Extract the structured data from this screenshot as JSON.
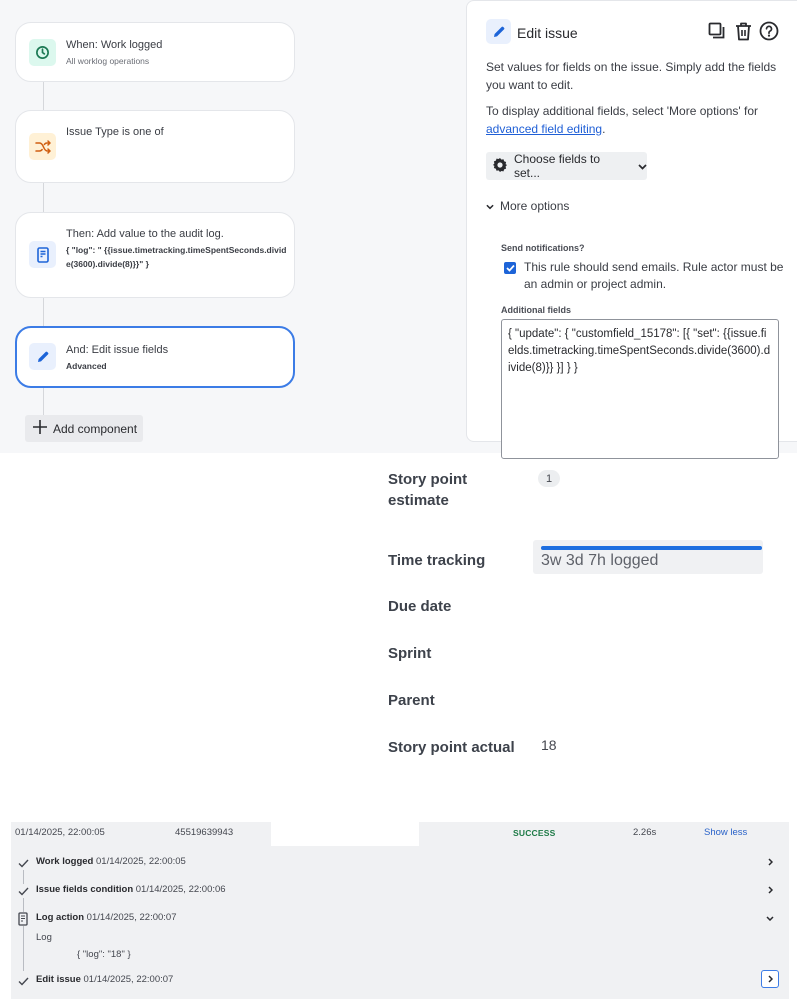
{
  "rule_editor": {
    "components": [
      {
        "title": "When: Work logged",
        "subtitle": "All worklog operations",
        "icon": "clock-icon",
        "icon_bg": "#dcf8ee",
        "icon_color": "#1d7a55"
      },
      {
        "title": "Issue Type is one of",
        "subtitle": "",
        "icon": "shuffle-icon",
        "icon_bg": "#fff1d6",
        "icon_color": "#d05f12"
      },
      {
        "title": "Then: Add value to the audit log.",
        "code": "{ \"log\": \" {{issue.timetracking.timeSpentSeconds.divide(3600).divide(8)}}\" }",
        "icon": "document-icon",
        "icon_bg": "#e9f0fd",
        "icon_color": "#1d64d8"
      },
      {
        "title": "And: Edit issue fields",
        "subtitle": "Advanced",
        "icon": "pencil-icon",
        "icon_bg": "#e9f0fd",
        "icon_color": "#1d64d8",
        "selected": true
      }
    ],
    "add_component_label": "Add component"
  },
  "edit_panel": {
    "title": "Edit issue",
    "tools": [
      "duplicate-icon",
      "delete-icon",
      "help-icon"
    ],
    "description": "Set values for fields on the issue. Simply add the fields you want to edit.",
    "additional_text": "To display additional fields, select 'More options' for",
    "advanced_link": "advanced field editing",
    "advanced_link_suffix": ".",
    "choose_fields_label": "Choose fields to set...",
    "more_options_label": "More options",
    "send_notifications_label": "Send notifications?",
    "send_notifications_checked": true,
    "send_notifications_text": "This rule should send emails. Rule actor must be an admin or project admin.",
    "additional_fields_label": "Additional fields",
    "additional_fields_value": "{ \"update\": { \"customfield_15178\": [{ \"set\": {{issue.fields.timetracking.timeSpentSeconds.divide(3600).divide(8)}} }] } }"
  },
  "issue_fields": {
    "story_point_estimate": {
      "label": "Story point estimate",
      "value": "1"
    },
    "time_tracking": {
      "label": "Time tracking",
      "value": "3w 3d 7h logged",
      "progress_percent": 100
    },
    "due_date": {
      "label": "Due date"
    },
    "sprint": {
      "label": "Sprint"
    },
    "parent": {
      "label": "Parent"
    },
    "story_point_actual": {
      "label": "Story point actual",
      "value": "18"
    }
  },
  "audit_log": {
    "row": {
      "timestamp": "01/14/2025, 22:00:05",
      "id": "45519639943",
      "status": "SUCCESS",
      "duration": "2.26s",
      "toggle_label": "Show less",
      "status_color": "#1d7a46"
    },
    "steps": [
      {
        "name": "Work logged",
        "time": "01/14/2025, 22:00:05",
        "icon": "check-icon",
        "expand": "chevron-right-icon"
      },
      {
        "name": "Issue fields condition",
        "time": "01/14/2025, 22:00:06",
        "icon": "check-icon",
        "expand": "chevron-right-icon"
      },
      {
        "name": "Log action",
        "time": "01/14/2025, 22:00:07",
        "icon": "document-icon",
        "expand": "chevron-down-icon",
        "detail_label": "Log",
        "detail_value": "{ \"log\": \"18\" }"
      },
      {
        "name": "Edit issue",
        "time": "01/14/2025, 22:00:07",
        "icon": "check-icon",
        "expand": "chevron-right-icon"
      }
    ]
  },
  "colors": {
    "accent": "#1d64d8",
    "selected_border": "#3c7ce6",
    "link": "#1f5fd6",
    "progress": "#1e6fe0"
  }
}
